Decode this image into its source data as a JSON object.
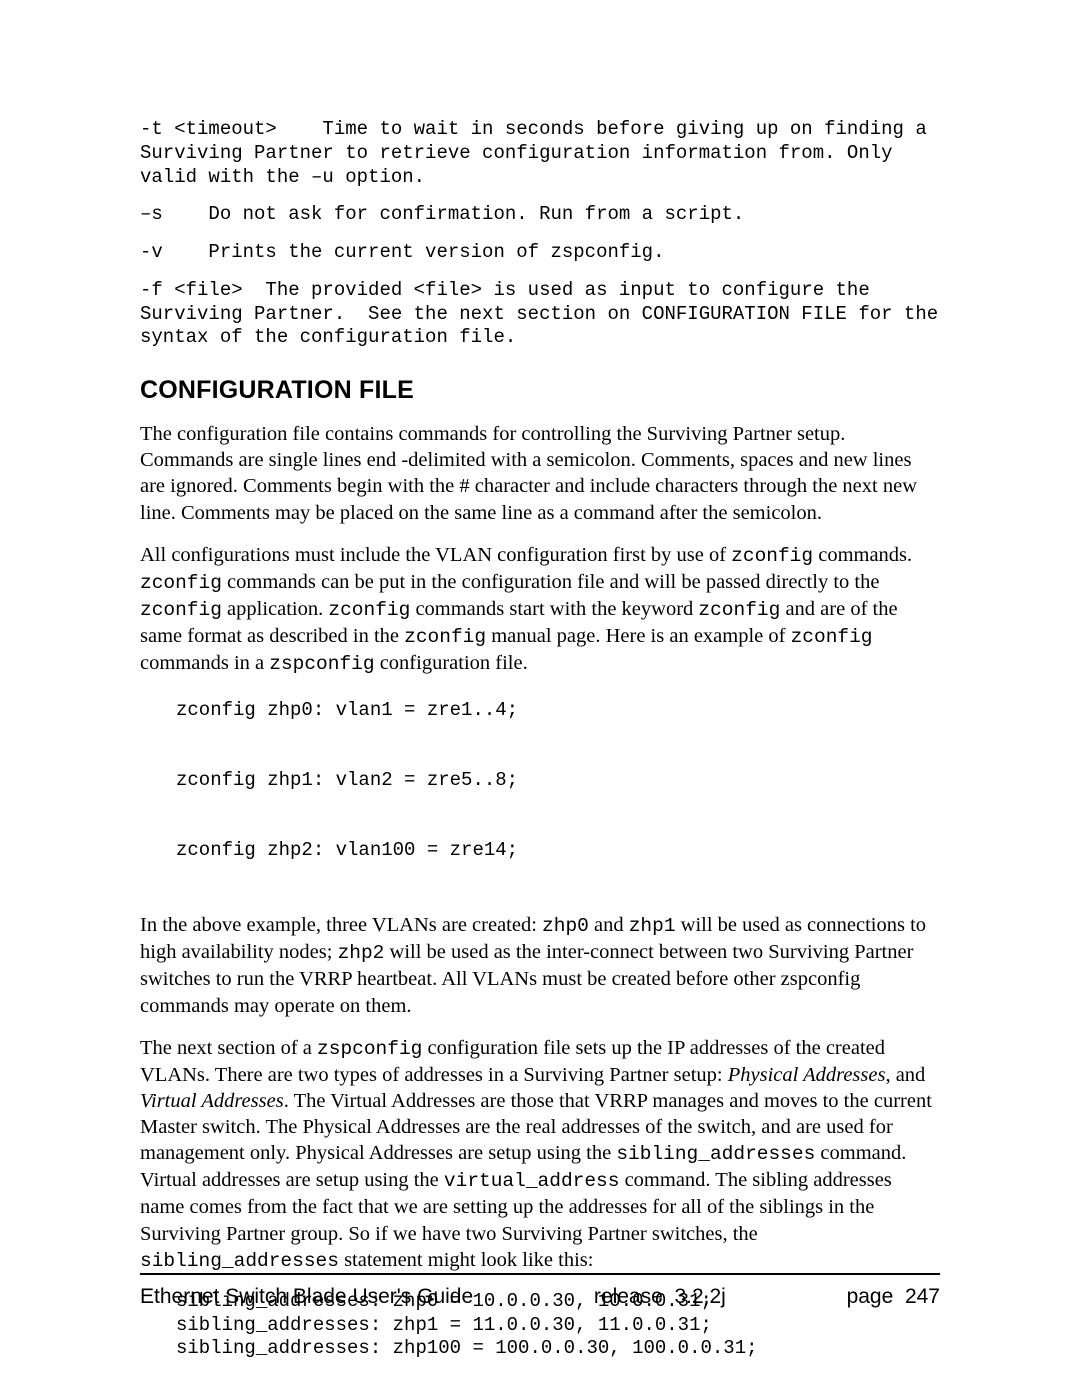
{
  "options": {
    "t": "-t <timeout>    Time to wait in seconds before giving up on finding a Surviving Partner to retrieve configuration information from. Only valid with the –u option.",
    "s": "–s    Do not ask for confirmation. Run from a script.",
    "v": "-v    Prints the current version of zspconfig.",
    "f": "-f <file>  The provided <file> is used as input to configure the Surviving Partner.  See the next section on CONFIGURATION FILE for the syntax of the configuration file."
  },
  "section_title": "CONFIGURATION FILE",
  "para1": "The configuration file contains commands for controlling the Surviving Partner setup. Commands are single lines end -delimited with a semicolon.  Comments, spaces and new lines are ignored. Comments begin with the # character and include characters through the next new line. Comments may be placed on the same line as a command after the semicolon.",
  "para2": {
    "a": "All configurations must include the VLAN configuration first by use of ",
    "b": " commands. ",
    "c": " commands can be put in the configuration file and will be passed directly to the ",
    "d": " application.  ",
    "e": " commands start with the keyword ",
    "f": " and are of the same format as described in the ",
    "g": " manual page.  Here is an example of ",
    "h": " commands in a ",
    "i": " configuration file.",
    "zconfig": "zconfig",
    "zspconfig": "zspconfig"
  },
  "code1": "zconfig zhp0: vlan1 = zre1..4;\n\nzconfig zhp1: vlan2 = zre5..8;\n\nzconfig zhp2: vlan100 = zre14;",
  "para3": {
    "a": "In the above example, three VLANs are created:  ",
    "b": " and ",
    "c": " will be used as connections to high availability nodes; ",
    "d": " will be used as the inter-connect between two Surviving Partner switches to run the VRRP heartbeat.  All VLANs must be created before other zspconfig commands may operate on them.",
    "zhp0": "zhp0",
    "zhp1": "zhp1",
    "zhp2": "zhp2"
  },
  "para4": {
    "a": "The next section of a ",
    "b": " configuration file sets up the IP addresses of the created VLANs.  There are two types of addresses in a Surviving Partner setup: ",
    "c": ", and ",
    "d": ".  The Virtual Addresses are those that VRRP manages and moves to the current Master switch.  The Physical Addresses are the real addresses of the switch, and are used for management only.  Physical Addresses are setup using the ",
    "e": " command. Virtual addresses are setup using the ",
    "f": " command.  The sibling addresses name comes from the fact that we are setting up the addresses for all of the siblings in the Surviving Partner group.  So if we have two Surviving Partner switches, the ",
    "g": " statement might look like this:",
    "zspconfig": "zspconfig",
    "phys": "Physical Addresses",
    "virt": "Virtual Addresses",
    "sib_cmd": "sibling_addresses",
    "virt_cmd": "virtual_address"
  },
  "code2": "sibling_addresses: zhp0 = 10.0.0.30, 10.0.0.31;\nsibling_addresses: zhp1 = 11.0.0.30, 11.0.0.31;\nsibling_addresses: zhp100 = 100.0.0.30, 100.0.0.31;",
  "footer": {
    "left": "Ethernet Switch Blade User's Guide",
    "mid": "release  3.2.2j",
    "right": "page  247"
  }
}
